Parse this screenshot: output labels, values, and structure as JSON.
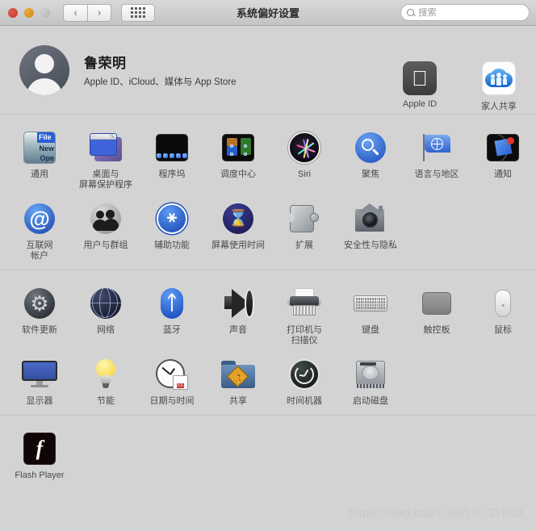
{
  "window": {
    "title": "系统偏好设置",
    "traffic_lights": [
      "close",
      "minimize",
      "zoom"
    ],
    "nav_back": "‹",
    "nav_forward": "›",
    "grid_button": "show-all-grid"
  },
  "search": {
    "placeholder": "搜索",
    "value": ""
  },
  "account": {
    "name": "鲁荣明",
    "subtitle": "Apple ID、iCloud、媒体与 App Store",
    "tiles": [
      {
        "label": "Apple ID",
        "icon": "apple-logo-icon"
      },
      {
        "label": "家人共享",
        "icon": "family-sharing-icon"
      }
    ]
  },
  "sections": [
    {
      "id": "personal",
      "rows": [
        [
          {
            "label": "通用",
            "icon": "general-icon"
          },
          {
            "label": "桌面与\n屏幕保护程序",
            "icon": "desktop-screensaver-icon"
          },
          {
            "label": "程序坞",
            "icon": "dock-icon"
          },
          {
            "label": "调度中心",
            "icon": "mission-control-icon"
          },
          {
            "label": "Siri",
            "icon": "siri-icon"
          },
          {
            "label": "聚焦",
            "icon": "spotlight-icon"
          },
          {
            "label": "语言与地区",
            "icon": "language-region-icon"
          },
          {
            "label": "通知",
            "icon": "notifications-icon"
          }
        ],
        [
          {
            "label": "互联网\n帐户",
            "icon": "internet-accounts-icon"
          },
          {
            "label": "用户与群组",
            "icon": "users-groups-icon"
          },
          {
            "label": "辅助功能",
            "icon": "accessibility-icon"
          },
          {
            "label": "屏幕使用时间",
            "icon": "screen-time-icon"
          },
          {
            "label": "扩展",
            "icon": "extensions-icon"
          },
          {
            "label": "安全性与隐私",
            "icon": "security-privacy-icon"
          }
        ]
      ]
    },
    {
      "id": "hardware",
      "rows": [
        [
          {
            "label": "软件更新",
            "icon": "software-update-icon"
          },
          {
            "label": "网络",
            "icon": "network-icon"
          },
          {
            "label": "蓝牙",
            "icon": "bluetooth-icon"
          },
          {
            "label": "声音",
            "icon": "sound-icon"
          },
          {
            "label": "打印机与\n扫描仪",
            "icon": "printers-scanners-icon"
          },
          {
            "label": "键盘",
            "icon": "keyboard-icon"
          },
          {
            "label": "触控板",
            "icon": "trackpad-icon"
          },
          {
            "label": "鼠标",
            "icon": "mouse-icon"
          }
        ],
        [
          {
            "label": "显示器",
            "icon": "displays-icon"
          },
          {
            "label": "节能",
            "icon": "energy-saver-icon"
          },
          {
            "label": "日期与时间",
            "icon": "date-time-icon"
          },
          {
            "label": "共享",
            "icon": "sharing-icon"
          },
          {
            "label": "时间机器",
            "icon": "time-machine-icon"
          },
          {
            "label": "启动磁盘",
            "icon": "startup-disk-icon"
          }
        ]
      ]
    },
    {
      "id": "third-party",
      "rows": [
        [
          {
            "label": "Flash Player",
            "icon": "flash-player-icon"
          }
        ]
      ]
    }
  ],
  "calendar_icon": {
    "month": "JUL",
    "day": "18"
  },
  "watermark": "https://blog.csdn.net/LU_ZHAO",
  "colors": {
    "window_bg": "#d3d3d3",
    "titlebar_top": "#d9d9d9",
    "titlebar_bottom": "#c4c4c4",
    "accent_blue": "#2563d6",
    "close_red": "#c8352a",
    "min_amber": "#d18b13"
  }
}
